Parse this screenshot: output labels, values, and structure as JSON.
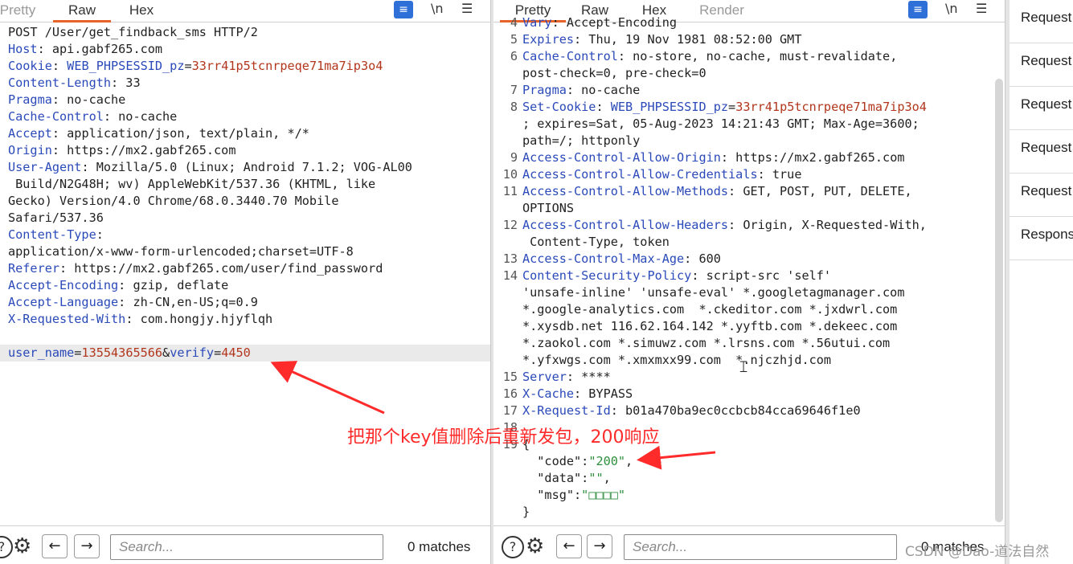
{
  "request": {
    "tabs": [
      "Pretty",
      "Raw",
      "Hex"
    ],
    "active_tab": "Raw",
    "lines": [
      {
        "parts": [
          {
            "t": "POST /User/get_findback_sms HTTP/2",
            "c": "val"
          }
        ]
      },
      {
        "parts": [
          {
            "t": "Host",
            "c": "key"
          },
          {
            "t": ": api.gabf265.com",
            "c": "val"
          }
        ]
      },
      {
        "parts": [
          {
            "t": "Cookie",
            "c": "key"
          },
          {
            "t": ": ",
            "c": "val"
          },
          {
            "t": "WEB_PHPSESSID_pz",
            "c": "key"
          },
          {
            "t": "=",
            "c": "val"
          },
          {
            "t": "33rr41p5tcnrpeqe71ma7ip3o4",
            "c": "red"
          }
        ]
      },
      {
        "parts": [
          {
            "t": "Content-Length",
            "c": "key"
          },
          {
            "t": ": 33",
            "c": "val"
          }
        ]
      },
      {
        "parts": [
          {
            "t": "Pragma",
            "c": "key"
          },
          {
            "t": ": no-cache",
            "c": "val"
          }
        ]
      },
      {
        "parts": [
          {
            "t": "Cache-Control",
            "c": "key"
          },
          {
            "t": ": no-cache",
            "c": "val"
          }
        ]
      },
      {
        "parts": [
          {
            "t": "Accept",
            "c": "key"
          },
          {
            "t": ": application/json, text/plain, */*",
            "c": "val"
          }
        ]
      },
      {
        "parts": [
          {
            "t": "Origin",
            "c": "key"
          },
          {
            "t": ": https://mx2.gabf265.com",
            "c": "val"
          }
        ]
      },
      {
        "parts": [
          {
            "t": "User-Agent",
            "c": "key"
          },
          {
            "t": ": Mozilla/5.0 (Linux; Android 7.1.2; VOG-AL00",
            "c": "val"
          }
        ]
      },
      {
        "parts": [
          {
            "t": " Build/N2G48H; wv) AppleWebKit/537.36 (KHTML, like",
            "c": "val"
          }
        ]
      },
      {
        "parts": [
          {
            "t": "Gecko) Version/4.0 Chrome/68.0.3440.70 Mobile",
            "c": "val"
          }
        ]
      },
      {
        "parts": [
          {
            "t": "Safari/537.36",
            "c": "val"
          }
        ]
      },
      {
        "parts": [
          {
            "t": "Content-Type",
            "c": "key"
          },
          {
            "t": ":",
            "c": "val"
          }
        ]
      },
      {
        "parts": [
          {
            "t": "application/x-www-form-urlencoded;charset=UTF-8",
            "c": "val"
          }
        ]
      },
      {
        "parts": [
          {
            "t": "Referer",
            "c": "key"
          },
          {
            "t": ": https://mx2.gabf265.com/user/find_password",
            "c": "val"
          }
        ]
      },
      {
        "parts": [
          {
            "t": "Accept-Encoding",
            "c": "key"
          },
          {
            "t": ": gzip, deflate",
            "c": "val"
          }
        ]
      },
      {
        "parts": [
          {
            "t": "Accept-Language",
            "c": "key"
          },
          {
            "t": ": zh-CN,en-US;q=0.9",
            "c": "val"
          }
        ]
      },
      {
        "parts": [
          {
            "t": "X-Requested-With",
            "c": "key"
          },
          {
            "t": ": com.hongjy.hjyflqh",
            "c": "val"
          }
        ]
      },
      {
        "parts": []
      },
      {
        "parts": [
          {
            "t": "user_name",
            "c": "key"
          },
          {
            "t": "=",
            "c": "val"
          },
          {
            "t": "13554365566",
            "c": "red"
          },
          {
            "t": "&",
            "c": "val"
          },
          {
            "t": "verify",
            "c": "key"
          },
          {
            "t": "=",
            "c": "val"
          },
          {
            "t": "4450",
            "c": "red"
          }
        ],
        "hl": true
      }
    ],
    "search_placeholder": "Search...",
    "matches": "0 matches",
    "help_glyph": "?",
    "gear_glyph": "⚙",
    "prev_glyph": "←",
    "next_glyph": "→"
  },
  "response": {
    "tabs": [
      "Pretty",
      "Raw",
      "Hex",
      "Render"
    ],
    "active_tab": "Pretty",
    "lines": [
      {
        "n": "4",
        "parts": [
          {
            "t": "Vary",
            "c": "key"
          },
          {
            "t": ": Accept-Encoding",
            "c": "val"
          }
        ]
      },
      {
        "n": "5",
        "parts": [
          {
            "t": "Expires",
            "c": "key"
          },
          {
            "t": ": Thu, 19 Nov 1981 08:52:00 GMT",
            "c": "val"
          }
        ]
      },
      {
        "n": "6",
        "parts": [
          {
            "t": "Cache-Control",
            "c": "key"
          },
          {
            "t": ": no-store, no-cache, must-revalidate,",
            "c": "val"
          }
        ]
      },
      {
        "n": "",
        "parts": [
          {
            "t": "post-check=0, pre-check=0",
            "c": "val"
          }
        ]
      },
      {
        "n": "7",
        "parts": [
          {
            "t": "Pragma",
            "c": "key"
          },
          {
            "t": ": no-cache",
            "c": "val"
          }
        ]
      },
      {
        "n": "8",
        "parts": [
          {
            "t": "Set-Cookie",
            "c": "key"
          },
          {
            "t": ": ",
            "c": "val"
          },
          {
            "t": "WEB_PHPSESSID_pz",
            "c": "key"
          },
          {
            "t": "=",
            "c": "val"
          },
          {
            "t": "33rr41p5tcnrpeqe71ma7ip3o4",
            "c": "red"
          }
        ]
      },
      {
        "n": "",
        "parts": [
          {
            "t": "; expires=Sat, 05-Aug-2023 14:21:43 GMT; Max-Age=3600;",
            "c": "val"
          }
        ]
      },
      {
        "n": "",
        "parts": [
          {
            "t": "path=/; httponly",
            "c": "val"
          }
        ]
      },
      {
        "n": "9",
        "parts": [
          {
            "t": "Access-Control-Allow-Origin",
            "c": "key"
          },
          {
            "t": ": https://mx2.gabf265.com",
            "c": "val"
          }
        ]
      },
      {
        "n": "10",
        "parts": [
          {
            "t": "Access-Control-Allow-Credentials",
            "c": "key"
          },
          {
            "t": ": true",
            "c": "val"
          }
        ]
      },
      {
        "n": "11",
        "parts": [
          {
            "t": "Access-Control-Allow-Methods",
            "c": "key"
          },
          {
            "t": ": GET, POST, PUT, DELETE,",
            "c": "val"
          }
        ]
      },
      {
        "n": "",
        "parts": [
          {
            "t": "OPTIONS",
            "c": "val"
          }
        ]
      },
      {
        "n": "12",
        "parts": [
          {
            "t": "Access-Control-Allow-Headers",
            "c": "key"
          },
          {
            "t": ": Origin, X-Requested-With,",
            "c": "val"
          }
        ]
      },
      {
        "n": "",
        "parts": [
          {
            "t": " Content-Type, token",
            "c": "val"
          }
        ]
      },
      {
        "n": "13",
        "parts": [
          {
            "t": "Access-Control-Max-Age",
            "c": "key"
          },
          {
            "t": ": 600",
            "c": "val"
          }
        ]
      },
      {
        "n": "14",
        "parts": [
          {
            "t": "Content-Security-Policy",
            "c": "key"
          },
          {
            "t": ": script-src 'self'",
            "c": "val"
          }
        ]
      },
      {
        "n": "",
        "parts": [
          {
            "t": "'unsafe-inline' 'unsafe-eval' *.googletagmanager.com",
            "c": "val"
          }
        ]
      },
      {
        "n": "",
        "parts": [
          {
            "t": "*.google-analytics.com  *.ckeditor.com *.jxdwrl.com",
            "c": "val"
          }
        ]
      },
      {
        "n": "",
        "parts": [
          {
            "t": "*.xysdb.net 116.62.164.142 *.yyftb.com *.dekeec.com",
            "c": "val"
          }
        ]
      },
      {
        "n": "",
        "parts": [
          {
            "t": "*.zaokol.com *.simuwz.com *.lrsns.com *.56utui.com",
            "c": "val"
          }
        ]
      },
      {
        "n": "",
        "parts": [
          {
            "t": "*.yfxwgs.com *.xmxmxx99.com  *.njczhjd.com",
            "c": "val"
          }
        ]
      },
      {
        "n": "15",
        "parts": [
          {
            "t": "Server",
            "c": "key"
          },
          {
            "t": ": ****",
            "c": "val"
          }
        ]
      },
      {
        "n": "16",
        "parts": [
          {
            "t": "X-Cache",
            "c": "key"
          },
          {
            "t": ": BYPASS",
            "c": "val"
          }
        ]
      },
      {
        "n": "17",
        "parts": [
          {
            "t": "X-Request-Id",
            "c": "key"
          },
          {
            "t": ": b01a470ba9ec0ccbcb84cca69646f1e0",
            "c": "val"
          }
        ]
      },
      {
        "n": "18",
        "parts": []
      },
      {
        "n": "19",
        "parts": [
          {
            "t": "{",
            "c": "val"
          }
        ]
      },
      {
        "n": "",
        "parts": [
          {
            "t": "  \"code\"",
            "c": "val"
          },
          {
            "t": ":",
            "c": "val"
          },
          {
            "t": "\"200\"",
            "c": "grn"
          },
          {
            "t": ",",
            "c": "val"
          }
        ]
      },
      {
        "n": "",
        "parts": [
          {
            "t": "  \"data\"",
            "c": "val"
          },
          {
            "t": ":",
            "c": "val"
          },
          {
            "t": "\"\"",
            "c": "grn"
          },
          {
            "t": ",",
            "c": "val"
          }
        ]
      },
      {
        "n": "",
        "parts": [
          {
            "t": "  \"msg\"",
            "c": "val"
          },
          {
            "t": ":",
            "c": "val"
          },
          {
            "t": "\"□□□□\"",
            "c": "grn"
          }
        ]
      },
      {
        "n": "",
        "parts": [
          {
            "t": "}",
            "c": "val"
          }
        ]
      }
    ],
    "search_placeholder": "Search...",
    "matches": "0 matches",
    "help_glyph": "?",
    "gear_glyph": "⚙",
    "prev_glyph": "←",
    "next_glyph": "→"
  },
  "toolbar": {
    "newline_label": "\\n",
    "menu_glyph": "☰",
    "wrap_glyph": "≡"
  },
  "sidebar": {
    "items": [
      "Request",
      "Request",
      "Request",
      "Request",
      "Request",
      "Respons"
    ]
  },
  "annotation": {
    "text": "把那个key值删除后重新发包，200响应",
    "color": "#ff2b2b"
  },
  "watermark": "CSDN @Dao-道法自然"
}
